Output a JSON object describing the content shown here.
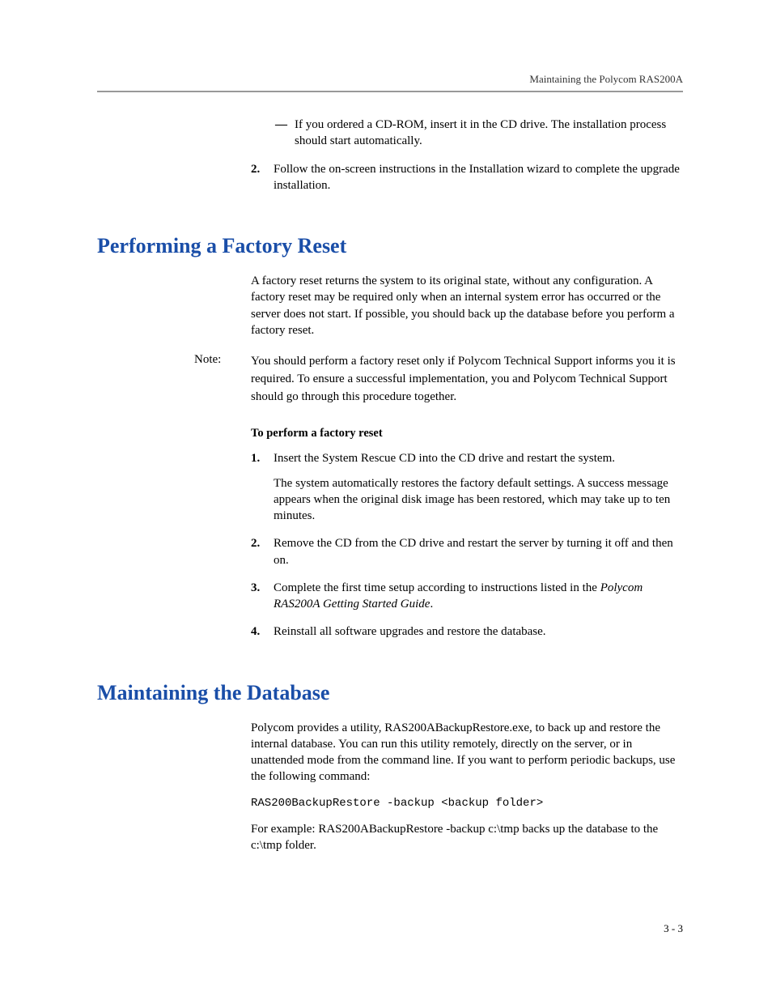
{
  "header": {
    "running_head": "Maintaining the Polycom RAS200A"
  },
  "top_continuation": {
    "bullet_dash": "—",
    "bullet_text": "If you ordered a CD-ROM, insert it in the CD drive. The installation process should start automatically.",
    "step2_num": "2.",
    "step2_text": "Follow the on-screen instructions in the Installation wizard to complete the upgrade installation."
  },
  "section_reset": {
    "heading": "Performing a Factory Reset",
    "intro": "A factory reset returns the system to its original state, without any configuration. A factory reset may be required only when an internal system error has occurred or the server does not start. If possible, you should back up the database before you perform a factory reset.",
    "note_label": "Note:",
    "note_body": "You should perform a factory reset only if Polycom Technical Support informs you it is required. To ensure a successful implementation, you and Polycom Technical Support should go through this procedure together.",
    "proc_heading": "To perform a factory reset",
    "steps": {
      "s1_num": "1.",
      "s1_text": "Insert the System Rescue CD into the CD drive and restart the system.",
      "s1_follow": "The system automatically restores the factory default settings. A success message appears when the original disk image has been restored, which may take up to ten minutes.",
      "s2_num": "2.",
      "s2_text": "Remove the CD from the CD drive and restart the server by turning it off and then on.",
      "s3_num": "3.",
      "s3_text_a": "Complete the first time setup according to instructions listed in the ",
      "s3_text_italic": "Polycom RAS200A Getting Started Guide",
      "s3_text_b": ".",
      "s4_num": "4.",
      "s4_text": "Reinstall all software upgrades and restore the database."
    }
  },
  "section_db": {
    "heading": "Maintaining the Database",
    "intro": "Polycom provides a utility, RAS200ABackupRestore.exe, to back up and restore the internal database. You can run this utility remotely, directly on the server, or in unattended mode from the command line. If you want to perform periodic backups, use the following command:",
    "command": "RAS200BackupRestore -backup <backup folder>",
    "example": "For example: RAS200ABackupRestore -backup c:\\tmp backs up the database to the c:\\tmp folder."
  },
  "footer": {
    "page_number": "3 - 3"
  }
}
